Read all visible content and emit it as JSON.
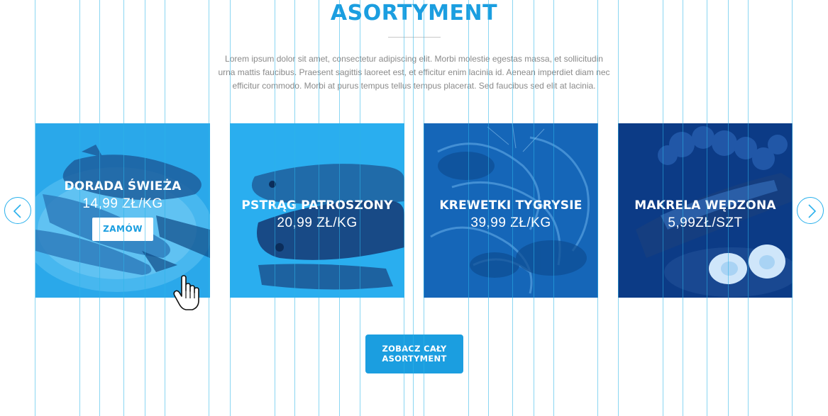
{
  "section": {
    "title": "ASORTYMENT",
    "intro_lines": [
      "Lorem ipsum dolor sit amet, consectetur adipiscing elit. Morbi molestie egestas massa, et sollicitudin",
      "urna mattis faucibus. Praesent sagittis laoreet est, et efficitur enim lacinia id. Aenean imperdiet diam nec",
      "efficitur commodo. Morbi at purus tempus tellus tempus placerat. Sed faucibus sed elit at lacinia."
    ]
  },
  "carousel": {
    "prev_icon": "chevron-left-icon",
    "next_icon": "chevron-right-icon",
    "products": [
      {
        "name": "DORADA ŚWIEŻA",
        "price": "14,99 ZŁ/KG",
        "button": "ZAMÓW",
        "image": "sea-bream-image",
        "color": "#2aa8ea"
      },
      {
        "name": "PSTRĄG PATROSZONY",
        "price": "20,99 ZŁ/KG",
        "image": "trout-image",
        "color": "#2aaeef"
      },
      {
        "name": "KREWETKI TYGRYSIE",
        "price": "39,99 ZŁ/KG",
        "image": "tiger-prawns-image",
        "color": "#1566b8"
      },
      {
        "name": "MAKRELA WĘDZONA",
        "price": "5,99ZŁ/SZT",
        "image": "smoked-mackerel-image",
        "color": "#0c3b86"
      }
    ]
  },
  "cta": {
    "line1": "ZOBACZ CAŁY",
    "line2": "ASORTYMENT"
  },
  "colors": {
    "accent": "#1b9ee0",
    "text_muted": "#8a8a8a",
    "grid_line": "#2cb4e8"
  }
}
